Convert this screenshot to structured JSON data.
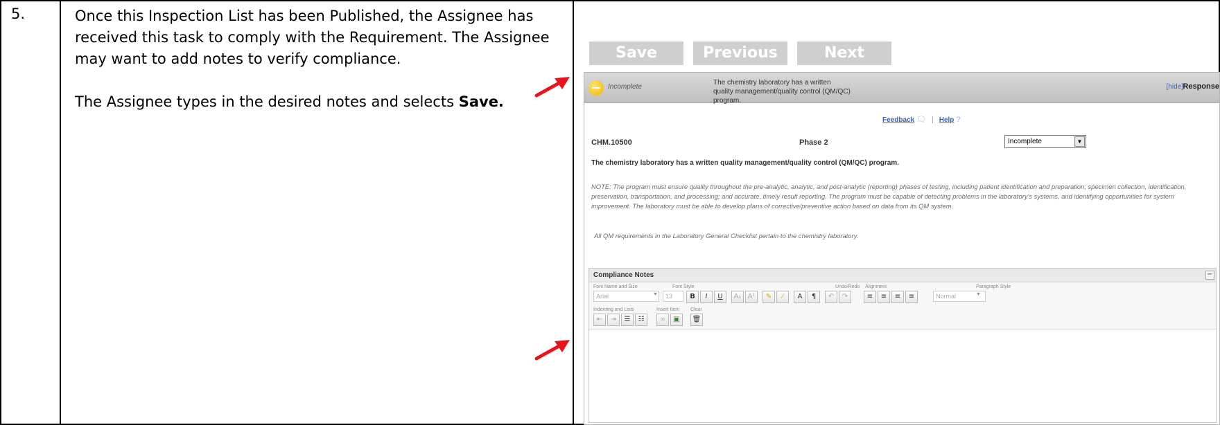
{
  "step": {
    "number": "5.",
    "line1": "Once this Inspection List has been Published, the Assignee has received this task to comply with the Requirement.  The Assignee may want to add notes to verify compliance.",
    "line2_prefix": "The Assignee types in the desired notes and selects ",
    "line2_bold": "Save."
  },
  "nav": {
    "save_label": "Save",
    "previous_label": "Previous",
    "next_label": "Next"
  },
  "panel": {
    "status": "Incomplete",
    "title": "The chemistry laboratory has a written quality management/quality control (QM/QC) program.",
    "hide_link": "[hide]",
    "response_label": "Response",
    "feedback_link": "Feedback",
    "help_link": "Help",
    "requirement_id": "CHM.10500",
    "phase": "Phase 2",
    "status_select": "Incomplete",
    "requirement_text": "The chemistry laboratory has a written quality management/quality control (QM/QC) program.",
    "note": "NOTE:  The program must ensure quality throughout the pre-analytic, analytic, and post-analytic (reporting) phases of testing, including patient identification and preparation; specimen collection, identification, preservation, transportation, and processing; and accurate, timely result reporting.  The program must be capable of detecting problems in the laboratory's systems, and identifying opportunities for system improvement.  The laboratory must be able to develop plans of corrective/preventive action based on data from its QM system.",
    "note2": "All QM requirements in the Laboratory General Checklist pertain to the chemistry laboratory."
  },
  "compliance_notes": {
    "title": "Compliance Notes",
    "collapse": "−",
    "groups": {
      "font_name_size": "Font Name and Size",
      "font_style": "Font Style",
      "undo_redo": "Undo/Redo",
      "alignment": "Alignment",
      "paragraph_style": "Paragraph Style",
      "indenting_lists": "Indenting and Lists",
      "insert_item": "Insert Item",
      "clear": "Clear"
    },
    "font_name": "Arial",
    "font_size": "13",
    "paragraph_style_value": "Normal",
    "editor_text": ""
  },
  "colors": {
    "nav_button": "#cfcfcf",
    "link_blue": "#3a64b8",
    "arrow_red": "#e8141b",
    "status_yellow": "#f0b400"
  },
  "icons": [
    "minus-circle-icon",
    "speech-bubble-icon",
    "question-mark-icon",
    "bold-icon",
    "italic-icon",
    "underline-icon",
    "subscript-icon",
    "superscript-icon",
    "highlight-icon",
    "eraser-icon",
    "font-color-icon",
    "pilcrow-icon",
    "undo-icon",
    "redo-icon",
    "align-left-icon",
    "align-center-icon",
    "align-right-icon",
    "justify-icon",
    "outdent-icon",
    "indent-icon",
    "bullet-list-icon",
    "number-list-icon",
    "link-icon",
    "image-icon",
    "trash-icon",
    "red-arrow-icon"
  ]
}
